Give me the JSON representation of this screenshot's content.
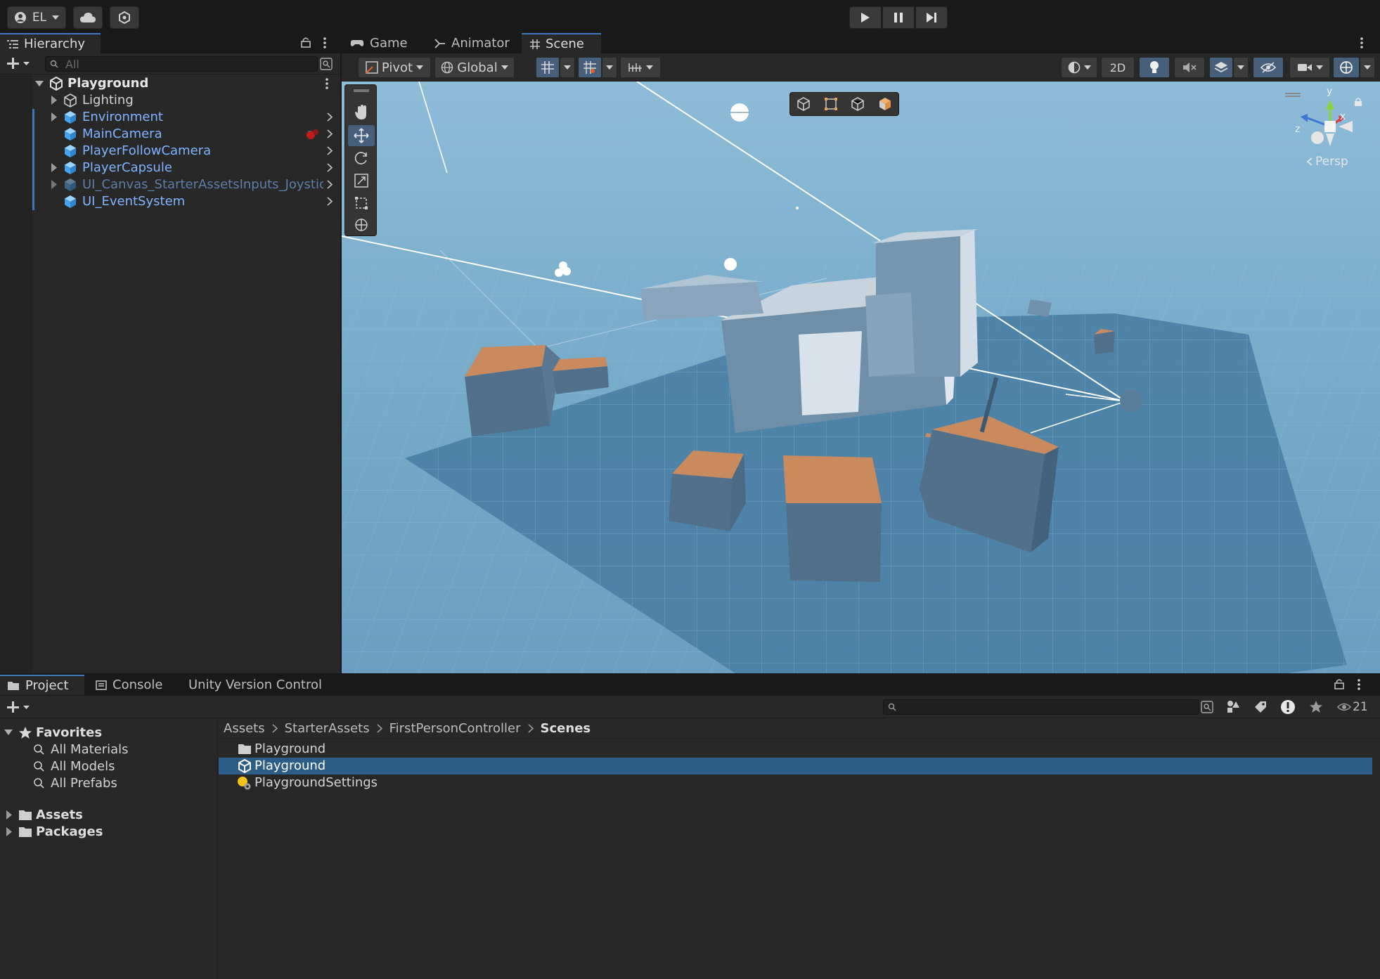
{
  "topbar": {
    "account_label": "EL",
    "icons": [
      "user-icon",
      "cloud-icon",
      "services-icon",
      "play-icon",
      "pause-icon",
      "step-icon"
    ]
  },
  "hierarchy": {
    "tab_label": "Hierarchy",
    "search_placeholder": "All",
    "scene_name": "Playground",
    "items": [
      {
        "label": "Lighting",
        "style": "plain",
        "expandable": true
      },
      {
        "label": "Environment",
        "style": "prefab",
        "expandable": true
      },
      {
        "label": "MainCamera",
        "style": "prefab",
        "expandable": false
      },
      {
        "label": "PlayerFollowCamera",
        "style": "prefab",
        "expandable": false
      },
      {
        "label": "PlayerCapsule",
        "style": "prefab",
        "expandable": true
      },
      {
        "label": "UI_Canvas_StarterAssetsInputs_Joystic",
        "style": "prefab-disabled",
        "expandable": true
      },
      {
        "label": "UI_EventSystem",
        "style": "prefab",
        "expandable": false
      }
    ]
  },
  "scene_tabs": [
    {
      "label": "Game",
      "icon": "gamepad-icon",
      "active": false
    },
    {
      "label": "Animator",
      "icon": "animator-icon",
      "active": false
    },
    {
      "label": "Scene",
      "icon": "grid-icon",
      "active": true
    }
  ],
  "scene_toolbar": {
    "pivot_label": "Pivot",
    "global_label": "Global",
    "mode_2d_label": "2D"
  },
  "scene_view": {
    "persp_label": "Persp",
    "gizmo_axes": [
      "y",
      "x",
      "z"
    ],
    "sky_color": "#7fb1d1",
    "ground_color": "#4a7ea4",
    "box_top_color": "#c98a5e",
    "box_side_color": "#53708a"
  },
  "bottom_tabs": [
    {
      "label": "Project",
      "icon": "folder-icon",
      "active": true
    },
    {
      "label": "Console",
      "icon": "console-icon",
      "active": false
    },
    {
      "label": "Unity Version Control",
      "icon": "",
      "active": false
    }
  ],
  "project": {
    "hidden_count": "21",
    "favorites_label": "Favorites",
    "favorites": [
      "All Materials",
      "All Models",
      "All Prefabs"
    ],
    "roots": [
      "Assets",
      "Packages"
    ],
    "breadcrumb": [
      "Assets",
      "StarterAssets",
      "FirstPersonController",
      "Scenes"
    ],
    "files": [
      {
        "label": "Playground",
        "icon": "folder-icon",
        "selected": false
      },
      {
        "label": "Playground",
        "icon": "unity-scene-icon",
        "selected": true
      },
      {
        "label": "PlaygroundSettings",
        "icon": "lighting-settings-icon",
        "selected": false
      }
    ]
  },
  "colors": {
    "accent": "#3a79bb",
    "selection": "#2c5d87",
    "prefab_text": "#7fb4ff"
  }
}
